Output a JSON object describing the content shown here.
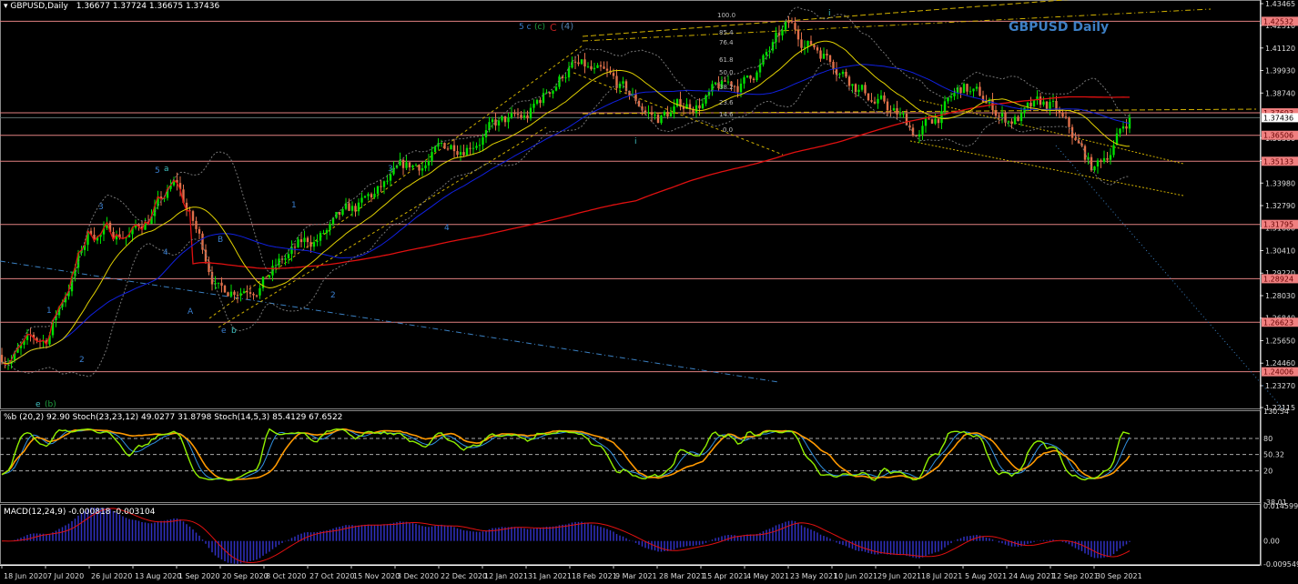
{
  "header": {
    "symbol": "GBPUSD,Daily",
    "ohlc": "1.36677 1.37724 1.36675 1.37436",
    "chart_title": "GBPUSD Daily"
  },
  "stoch_header": "%b (20,2) 92.90  Stoch(23,23,12) 49.0277 31.8798  Stoch(14,5,3) 85.4129 67.6522",
  "macd_header": "MACD(12,24,9) -0.000818 -0.003104",
  "colors": {
    "bull": "#00e000",
    "bear": "#e0704a",
    "ma_long": "#e01010",
    "ma_mid": "#1020e0",
    "ma_short": "#e0d000",
    "level_line": "#e08080",
    "stoch_fast": "#90f000",
    "stoch_slow": "#ff9900",
    "stoch_signal": "#3090e0",
    "macd_hist": "#3030c0",
    "macd_signal": "#e01010"
  },
  "chart_data": {
    "type": "candlestick",
    "symbol": "GBPUSD",
    "timeframe": "Daily",
    "ylim": [
      1.22115,
      1.43465
    ],
    "price_ticks": [
      "1.43465",
      "1.42310",
      "1.41120",
      "1.39930",
      "1.38740",
      "1.36360",
      "1.35170",
      "1.33980",
      "1.32790",
      "1.31600",
      "1.30410",
      "1.29220",
      "1.28030",
      "1.26840",
      "1.25650",
      "1.24460",
      "1.23270",
      "1.22115"
    ],
    "x_ticks": [
      "18 Jun 2020",
      "7 Jul 2020",
      "26 Jul 2020",
      "13 Aug 2020",
      "1 Sep 2020",
      "20 Sep 2020",
      "8 Oct 2020",
      "27 Oct 2020",
      "15 Nov 2020",
      "3 Dec 2020",
      "22 Dec 2020",
      "12 Jan 2021",
      "31 Jan 2021",
      "18 Feb 2021",
      "9 Mar 2021",
      "28 Mar 2021",
      "15 Apr 2021",
      "4 May 2021",
      "23 May 2021",
      "10 Jun 2021",
      "29 Jun 2021",
      "18 Jul 2021",
      "5 Aug 2021",
      "24 Aug 2021",
      "12 Sep 2021",
      "30 Sep 2021"
    ],
    "approx_close_at_ticks": [
      1.249,
      1.256,
      1.314,
      1.314,
      1.338,
      1.283,
      1.292,
      1.307,
      1.321,
      1.34,
      1.355,
      1.369,
      1.372,
      1.403,
      1.389,
      1.374,
      1.384,
      1.393,
      1.42,
      1.408,
      1.384,
      1.365,
      1.389,
      1.374,
      1.379,
      1.345
    ],
    "last_close": 1.37436,
    "current_price_label": "1.37436",
    "horizontal_levels": [
      "1.42532",
      "1.37693",
      "1.36506",
      "1.35133",
      "1.31795",
      "1.28924",
      "1.26623",
      "1.24006"
    ],
    "fib_levels": [
      "100.0",
      "85.4",
      "76.4",
      "61.8",
      "50.0",
      "38.2",
      "23.6",
      "14.6",
      "0.0"
    ],
    "wave_labels": [
      "5 c",
      "(c)",
      "C",
      "(4)",
      "5",
      "a",
      "3",
      "1",
      "2",
      "e",
      "(b)",
      "4",
      "B",
      "A",
      "e",
      "b",
      "1",
      "2",
      "3",
      "4",
      "i",
      "i"
    ]
  },
  "stoch_panel": {
    "ylim": [
      -38.01,
      130.54
    ],
    "ticks": [
      "130.54",
      "80",
      "50.32",
      "20",
      "-38.01"
    ],
    "current": "50.32"
  },
  "macd_panel": {
    "ylim": [
      -0.009549,
      0.014599
    ],
    "ticks": [
      "0.014599",
      "0.00",
      "-0.009549"
    ]
  }
}
